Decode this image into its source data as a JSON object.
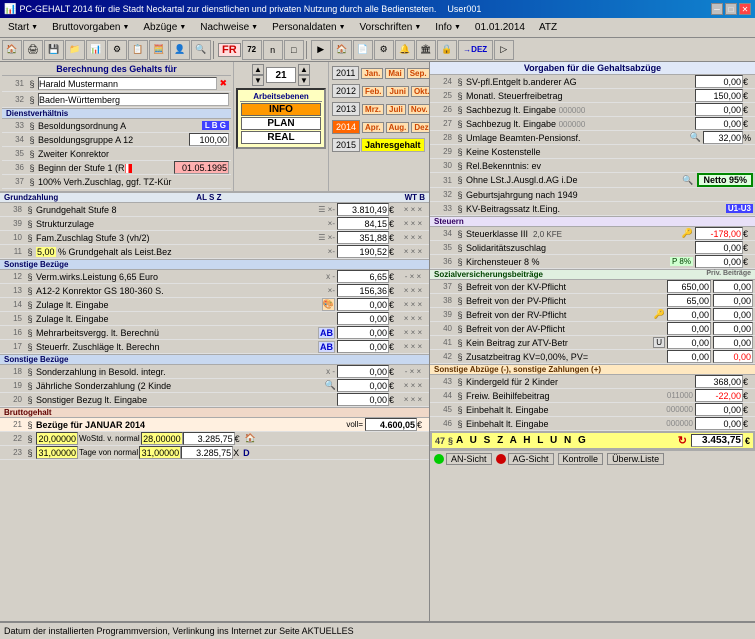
{
  "titleBar": {
    "title": "PC-GEHALT 2014 für die Stadt Neckartal zur dienstlichen und privaten Nutzung durch alle Bediensteten.",
    "user": "User001",
    "minBtn": "─",
    "maxBtn": "□",
    "closeBtn": "✕"
  },
  "menuBar": {
    "items": [
      {
        "label": "Start",
        "arrow": "▼"
      },
      {
        "label": "Bruttovorgaben",
        "arrow": "▼"
      },
      {
        "label": "Abzüge",
        "arrow": "▼"
      },
      {
        "label": "Nachweise",
        "arrow": "▼"
      },
      {
        "label": "Personaldaten",
        "arrow": "▼"
      },
      {
        "label": "Vorschriften",
        "arrow": "▼"
      },
      {
        "label": "Info",
        "arrow": "▼"
      },
      {
        "label": "01.01.2014"
      },
      {
        "label": "ATZ"
      }
    ]
  },
  "leftPanel": {
    "sectionHeader": "Berechnung des Gehalts für",
    "nameRow": {
      "num": "31",
      "name": "Harald Mustermann"
    },
    "cityRow": {
      "num": "32",
      "name": "Baden-Württemberg"
    },
    "arbeitsebene": {
      "label": "Arbeitsebenen",
      "info": "INFO",
      "plan": "PLAN",
      "real": "REAL"
    },
    "spinnerValue": "21",
    "dienstverhaltnis": {
      "header": "Dienstverhältnis",
      "lbg": "L B G",
      "rows": [
        {
          "num": "33",
          "para": "§",
          "label": "Besoldungsordnung A"
        },
        {
          "num": "34",
          "para": "§",
          "label": "Besoldungsgruppe A 12",
          "value": "100,00"
        },
        {
          "num": "35",
          "para": "§",
          "label": "Zweiter Konrektor"
        },
        {
          "num": "36",
          "para": "§",
          "label": "Beginn der Stufe 1 (R",
          "value": "01.05.1995",
          "highlight": true
        },
        {
          "num": "37",
          "para": "§",
          "label": "100% Verh.Zuschlag, ggf. TZ-Kür"
        }
      ]
    },
    "years": [
      {
        "year": "2011",
        "active": false
      },
      {
        "year": "2012",
        "active": false
      },
      {
        "year": "2013",
        "active": false
      },
      {
        "year": "2014",
        "active": true
      },
      {
        "year": "2015",
        "active": false
      }
    ],
    "months1": [
      "Jan.",
      "Mai",
      "Sep."
    ],
    "months2": [
      "Feb.",
      "Juni",
      "Okt."
    ],
    "months3": [
      "Mrz.",
      "Juli",
      "Nov."
    ],
    "months4": [
      "Apr.",
      "Aug.",
      "Dez."
    ],
    "jahresgehalt": "Jahresgehalt",
    "grundzahlung": {
      "header": "Grundzahlung",
      "colHeaders": [
        "AL S Z",
        "WT B"
      ],
      "rows": [
        {
          "num": "38",
          "para": "§",
          "label": "Grundgehalt Stufe 8",
          "icons": "☰ ×-",
          "value": "3.810,49",
          "unit": "€",
          "actions": "× × ×"
        },
        {
          "num": "39",
          "para": "§",
          "label": "Strukturzulage",
          "icons": "×-",
          "value": "84,15",
          "unit": "€",
          "actions": "× × ×"
        },
        {
          "num": "10",
          "para": "§",
          "label": "Fam.Zuschlag Stufe 3 (vh/2)",
          "icons": "☰ ×-",
          "value": "351,88",
          "unit": "€",
          "actions": "× × ×"
        },
        {
          "num": "11",
          "para": "§",
          "label": "5,00 % Grundgehalt als Leist.Bez",
          "icons": "×-",
          "value": "190,52",
          "unit": "€",
          "actions": "× × ×"
        }
      ]
    },
    "sonstigeBezuge": {
      "header": "Sonstige Bezüge",
      "rows": [
        {
          "num": "12",
          "para": "§",
          "label": "Verm.wirks.Leistung  6,65 Euro",
          "icons": "x -",
          "value": "6,65",
          "unit": "€",
          "actions": "- × ×"
        },
        {
          "num": "13",
          "para": "§",
          "label": "A12-2 Konrektor GS 180-360 S.",
          "icons": "×-",
          "value": "156,36",
          "unit": "€",
          "actions": "× × ×"
        },
        {
          "num": "14",
          "para": "§",
          "label": "Zulage lt. Eingabe",
          "icons": "🎨",
          "value": "0,00",
          "unit": "€",
          "actions": "× × ×"
        },
        {
          "num": "15",
          "para": "§",
          "label": "Zulage lt. Eingabe",
          "value": "0,00",
          "unit": "€",
          "actions": "× × ×"
        },
        {
          "num": "16",
          "para": "§",
          "label": "Mehrarbeitsvergg. lt. Berechnü",
          "icons": "AB",
          "value": "0,00",
          "unit": "€",
          "actions": "× × ×"
        },
        {
          "num": "17",
          "para": "§",
          "label": "Steuerfr. Zuschläge lt. Berechn",
          "icons": "AB",
          "value": "0,00",
          "unit": "€",
          "actions": "× × ×"
        }
      ]
    },
    "sonstigeBezuge2": {
      "header": "Sonstige Bezüge",
      "rows": [
        {
          "num": "18",
          "para": "§",
          "label": "Sonderzahlung in Besold. integr.",
          "icons": "x -",
          "value": "0,00",
          "unit": "€",
          "actions": "- × ×"
        },
        {
          "num": "19",
          "para": "§",
          "label": "Jährliche Sonderzahlung (2 Kinde",
          "icons": "🔍",
          "value": "0,00",
          "unit": "€",
          "actions": "× × ×"
        },
        {
          "num": "20",
          "para": "§",
          "label": "Sonstiger Bezug lt. Eingabe",
          "value": "0,00",
          "unit": "€",
          "actions": "× × ×"
        }
      ]
    },
    "bruttoPanel": {
      "header": "Bruttogehalt",
      "rows": [
        {
          "num": "21",
          "para": "§",
          "label": "Bezüge für JANUAR  2014",
          "labelSuffix": "voll=",
          "value": "4.600,05",
          "unit": "€"
        },
        {
          "num": "22",
          "para": "§",
          "label1": "20,00000",
          "label2": "WoStd. v. normal",
          "label3": "28,00000",
          "value": "3.285,75",
          "unit": "€",
          "icon": "🏠"
        },
        {
          "num": "23",
          "para": "§",
          "label1": "31,00000",
          "label2": "Tage von normal",
          "label3": "31,00000",
          "value": "3.285,75",
          "unit": "X",
          "icon": "D"
        }
      ]
    }
  },
  "rightPanel": {
    "headerLabel": "Vorgaben für die Gehaltsabzüge",
    "rows": [
      {
        "num": "24",
        "para": "§",
        "label": "SV-pfl.Entgelt b.anderer AG",
        "value": "0,00",
        "unit": "€"
      },
      {
        "num": "25",
        "para": "§",
        "label": "Monatl. Steuerfreibetrag",
        "value": "150,00",
        "unit": "€"
      },
      {
        "num": "26",
        "para": "§",
        "label": "Sachbezug lt. Eingabe 000000",
        "value": "0,00",
        "unit": "€"
      },
      {
        "num": "27",
        "para": "§",
        "label": "Sachbezug lt. Eingabe 000000",
        "value": "0,00",
        "unit": "€"
      },
      {
        "num": "28",
        "para": "§",
        "label": "Umlage Beamten-Pensionsf.",
        "value": "32,00",
        "unit": "%",
        "icon": "🔍"
      },
      {
        "num": "29",
        "para": "§",
        "label": "Keine Kostenstelle"
      },
      {
        "num": "30",
        "para": "§",
        "label": "Rel.Bekenntnis: ev"
      },
      {
        "num": "31",
        "para": "§",
        "label": "Ohne LSt.J.Ausgl.d.AG i.De",
        "icon": "🔍"
      },
      {
        "num": "32",
        "para": "§",
        "label": "Geburtsjahrgung nach 1949"
      },
      {
        "num": "33",
        "para": "§",
        "label": "KV-Beitragssatz lt.Eing.",
        "badge": "U1-U3"
      }
    ],
    "nettoBox": {
      "label": "Netto",
      "value": "95%"
    },
    "steuerSection": {
      "header": "Steuern",
      "rows": [
        {
          "num": "34",
          "para": "§",
          "label": "Steuerklasse III",
          "sub": "2,0 KFE",
          "icon": "🔑",
          "value": "-178,00",
          "unit": "€",
          "red": true
        },
        {
          "num": "35",
          "para": "§",
          "label": "Solidaritätszuschlag",
          "value": "0,00",
          "unit": "€"
        },
        {
          "num": "36",
          "para": "§",
          "label": "Kirchensteuer 8 %",
          "sub": "P 8%",
          "value": "0,00",
          "unit": "€"
        }
      ]
    },
    "svSection": {
      "header": "Sozialversicherungsbeiträge",
      "privHeader": "Priv. Beiträge",
      "rows": [
        {
          "num": "37",
          "para": "§",
          "label": "Befreit von der KV-Pflicht",
          "value1": "650,00",
          "value2": "0,00"
        },
        {
          "num": "38",
          "para": "§",
          "label": "Befreit von der PV-Pflicht",
          "value1": "65,00",
          "value2": "0,00"
        },
        {
          "num": "39",
          "para": "§",
          "label": "Befreit von der RV-Pflicht",
          "icon": "🔑",
          "value1": "0,00",
          "value2": "0,00"
        },
        {
          "num": "40",
          "para": "§",
          "label": "Befreit von der AV-Pflicht",
          "value1": "0,00",
          "value2": "0,00"
        },
        {
          "num": "41",
          "para": "§",
          "label": "Kein Beitrag zur ATV-Betr",
          "badge": "U",
          "value1": "0,00",
          "value2": "0,00"
        },
        {
          "num": "42",
          "para": "§",
          "label": "Zusatzbeitrag KV=0,00%, PV=",
          "value1": "0,00",
          "value2": "0,00",
          "redValue2": true
        }
      ]
    },
    "sonstigeAbzuge": {
      "header": "Sonstige Abzüge (-), sonstige Zahlungen (+)",
      "rows": [
        {
          "num": "43",
          "para": "§",
          "label": "Kindergeld für 2 Kinder",
          "value": "368,00",
          "unit": "€"
        },
        {
          "num": "44",
          "para": "§",
          "label": "Freiw. Beihilfebeitrag",
          "code": "011000",
          "value": "-22,00",
          "unit": "€",
          "red": true
        },
        {
          "num": "45",
          "para": "§",
          "label": "Einbehalt lt. Eingabe",
          "code": "000000",
          "value": "0,00",
          "unit": "€"
        },
        {
          "num": "46",
          "para": "§",
          "label": "Einbehalt lt. Eingabe",
          "code": "000000",
          "value": "0,00",
          "unit": "€"
        }
      ]
    },
    "auszahlung": {
      "num": "47",
      "label": "A U S Z A H L U N G",
      "value": "3.453,75",
      "unit": "€"
    },
    "bottomButtons": [
      {
        "label": "AN-Sicht"
      },
      {
        "label": "AG-Sicht"
      },
      {
        "label": "Kontrolle"
      },
      {
        "label": "Überw.Liste"
      }
    ]
  },
  "bottomBar": {
    "text": "Datum der installierten Programmversion, Verlinkung ins Internet zur Seite AKTUELLES"
  }
}
